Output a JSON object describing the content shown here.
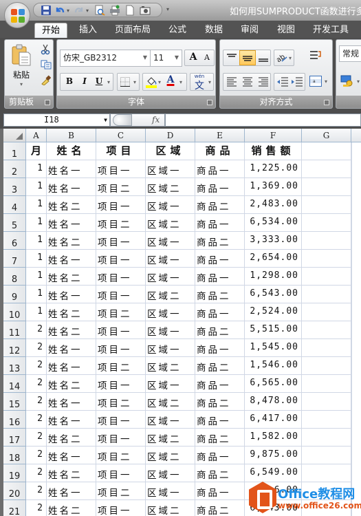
{
  "window": {
    "title": "如何用SUMPRODUCT函数进行多"
  },
  "quick_access": {
    "items": [
      "save",
      "undo",
      "redo",
      "print-preview",
      "quick-print",
      "new",
      "camera"
    ]
  },
  "tabs": [
    {
      "label": "开始",
      "active": true
    },
    {
      "label": "插入",
      "active": false
    },
    {
      "label": "页面布局",
      "active": false
    },
    {
      "label": "公式",
      "active": false
    },
    {
      "label": "数据",
      "active": false
    },
    {
      "label": "审阅",
      "active": false
    },
    {
      "label": "视图",
      "active": false
    },
    {
      "label": "开发工具",
      "active": false
    }
  ],
  "ribbon": {
    "clipboard": {
      "label": "剪贴板",
      "paste_label": "粘贴",
      "paste_arrow": "▾"
    },
    "font": {
      "label": "字体",
      "font_name": "仿宋_GB2312",
      "font_size": "11",
      "grow": "A",
      "shrink": "A",
      "bold": "B",
      "italic": "I",
      "underline": "U",
      "font_color_glyph": "A",
      "phonetic_top": "wén",
      "phonetic_char": "文",
      "fill_color": "#ffff00",
      "font_color": "#e00000"
    },
    "alignment": {
      "label": "对齐方式"
    },
    "number": {
      "format": "常规"
    }
  },
  "formula_bar": {
    "name_box": "I18",
    "fx": "fx",
    "formula": ""
  },
  "sheet": {
    "columns": [
      "A",
      "B",
      "C",
      "D",
      "E",
      "F",
      "G"
    ],
    "header_row": [
      "月",
      "姓名",
      "项目",
      "区域",
      "商品",
      "销售额"
    ],
    "rows": [
      {
        "n": "2",
        "cells": [
          "1",
          "姓名一",
          "项目一",
          "区域一",
          "商品一",
          "1,225.00"
        ]
      },
      {
        "n": "3",
        "cells": [
          "1",
          "姓名一",
          "项目二",
          "区域二",
          "商品一",
          "1,369.00"
        ]
      },
      {
        "n": "4",
        "cells": [
          "1",
          "姓名二",
          "项目一",
          "区域一",
          "商品二",
          "2,483.00"
        ]
      },
      {
        "n": "5",
        "cells": [
          "1",
          "姓名一",
          "项目二",
          "区域二",
          "商品一",
          "6,534.00"
        ]
      },
      {
        "n": "6",
        "cells": [
          "1",
          "姓名二",
          "项目一",
          "区域一",
          "商品二",
          "3,333.00"
        ]
      },
      {
        "n": "7",
        "cells": [
          "1",
          "姓名一",
          "项目一",
          "区域一",
          "商品一",
          "2,654.00"
        ]
      },
      {
        "n": "8",
        "cells": [
          "1",
          "姓名二",
          "项目一",
          "区域一",
          "商品一",
          "1,298.00"
        ]
      },
      {
        "n": "9",
        "cells": [
          "1",
          "姓名一",
          "项目一",
          "区域二",
          "商品二",
          "6,543.00"
        ]
      },
      {
        "n": "10",
        "cells": [
          "1",
          "姓名二",
          "项目二",
          "区域一",
          "商品一",
          "2,524.00"
        ]
      },
      {
        "n": "11",
        "cells": [
          "2",
          "姓名二",
          "项目一",
          "区域一",
          "商品二",
          "5,515.00"
        ]
      },
      {
        "n": "12",
        "cells": [
          "2",
          "姓名一",
          "项目一",
          "区域一",
          "商品一",
          "1,545.00"
        ]
      },
      {
        "n": "13",
        "cells": [
          "2",
          "姓名一",
          "项目二",
          "区域二",
          "商品二",
          "1,546.00"
        ]
      },
      {
        "n": "14",
        "cells": [
          "2",
          "姓名二",
          "项目一",
          "区域一",
          "商品一",
          "6,565.00"
        ]
      },
      {
        "n": "15",
        "cells": [
          "2",
          "姓名一",
          "项目二",
          "区域二",
          "商品二",
          "8,478.00"
        ]
      },
      {
        "n": "16",
        "cells": [
          "2",
          "姓名一",
          "项目一",
          "区域一",
          "商品一",
          "6,417.00"
        ]
      },
      {
        "n": "17",
        "cells": [
          "2",
          "姓名二",
          "项目一",
          "区域二",
          "商品二",
          "1,582.00"
        ]
      },
      {
        "n": "18",
        "cells": [
          "2",
          "姓名一",
          "项目二",
          "区域二",
          "商品一",
          "9,875.00"
        ]
      },
      {
        "n": "19",
        "cells": [
          "2",
          "姓名二",
          "项目一",
          "区域一",
          "商品二",
          "6,549.00"
        ]
      },
      {
        "n": "20",
        "cells": [
          "2",
          "姓名一",
          "项目二",
          "区域一",
          "商品一",
          "6.00"
        ]
      },
      {
        "n": "21",
        "cells": [
          "2",
          "姓名二",
          "项目一",
          "区域二",
          "商品二",
          "6,543.00"
        ]
      }
    ]
  },
  "watermark": {
    "title": "Office教程网",
    "url": "www.office26.com"
  }
}
